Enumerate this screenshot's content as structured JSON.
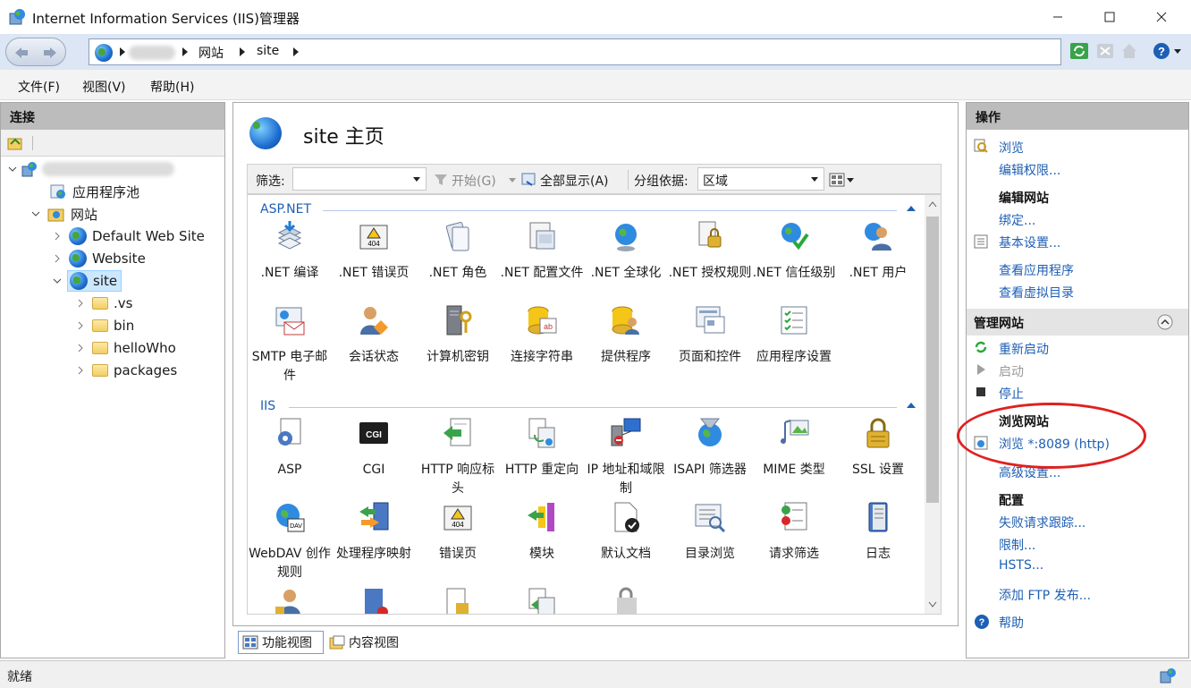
{
  "window": {
    "title": "Internet Information Services (IIS)管理器"
  },
  "address": {
    "crumbs": [
      "网站",
      "site"
    ]
  },
  "menu": [
    "文件(F)",
    "视图(V)",
    "帮助(H)"
  ],
  "connections": {
    "header": "连接",
    "tree": [
      {
        "label": "应用程序池",
        "icon": "app-pool-icon"
      },
      {
        "label": "网站",
        "icon": "sites-folder-icon"
      },
      {
        "label": "Default Web Site",
        "icon": "globe-icon"
      },
      {
        "label": "Website",
        "icon": "globe-icon"
      },
      {
        "label": "site",
        "icon": "globe-icon",
        "selected": true
      },
      {
        "label": ".vs",
        "icon": "folder-icon"
      },
      {
        "label": "bin",
        "icon": "folder-icon"
      },
      {
        "label": "helloWho",
        "icon": "folder-icon"
      },
      {
        "label": "packages",
        "icon": "folder-icon"
      }
    ]
  },
  "center": {
    "title": "site 主页",
    "filter_label": "筛选:",
    "start_label": "开始(G)",
    "show_all_label": "全部显示(A)",
    "group_label": "分组依据:",
    "group_value": "区域",
    "sections": [
      {
        "name": "ASP.NET",
        "features": [
          ".NET 编译",
          ".NET 错误页",
          ".NET 角色",
          ".NET 配置文件",
          ".NET 全球化",
          ".NET 授权规则",
          ".NET 信任级别",
          ".NET 用户",
          "SMTP 电子邮件",
          "会话状态",
          "计算机密钥",
          "连接字符串",
          "提供程序",
          "页面和控件",
          "应用程序设置"
        ]
      },
      {
        "name": "IIS",
        "features": [
          "ASP",
          "CGI",
          "HTTP 响应标头",
          "HTTP 重定向",
          "IP 地址和域限制",
          "ISAPI 筛选器",
          "MIME 类型",
          "SSL 设置",
          "WebDAV 创作规则",
          "处理程序映射",
          "错误页",
          "模块",
          "默认文档",
          "目录浏览",
          "请求筛选",
          "日志"
        ]
      }
    ],
    "view_tabs": [
      "功能视图",
      "内容视图"
    ]
  },
  "actions": {
    "header": "操作",
    "browse": "浏览",
    "edit_permissions": "编辑权限...",
    "edit_site_header": "编辑网站",
    "bindings": "绑定...",
    "basic_settings": "基本设置...",
    "view_apps": "查看应用程序",
    "view_vdirs": "查看虚拟目录",
    "manage_site_header": "管理网站",
    "restart": "重新启动",
    "start": "启动",
    "stop": "停止",
    "browse_site_header": "浏览网站",
    "browse_http": "浏览 *:8089 (http)",
    "advanced_settings": "高级设置...",
    "config_header": "配置",
    "failed_request_tracing": "失败请求跟踪...",
    "limits": "限制...",
    "hsts": "HSTS...",
    "add_ftp": "添加 FTP 发布...",
    "help": "帮助"
  },
  "status": {
    "text": "就绪"
  },
  "colors": {
    "link": "#1e5fb5",
    "highlight": "#e02020",
    "panel_header": "#bcbcbc"
  }
}
